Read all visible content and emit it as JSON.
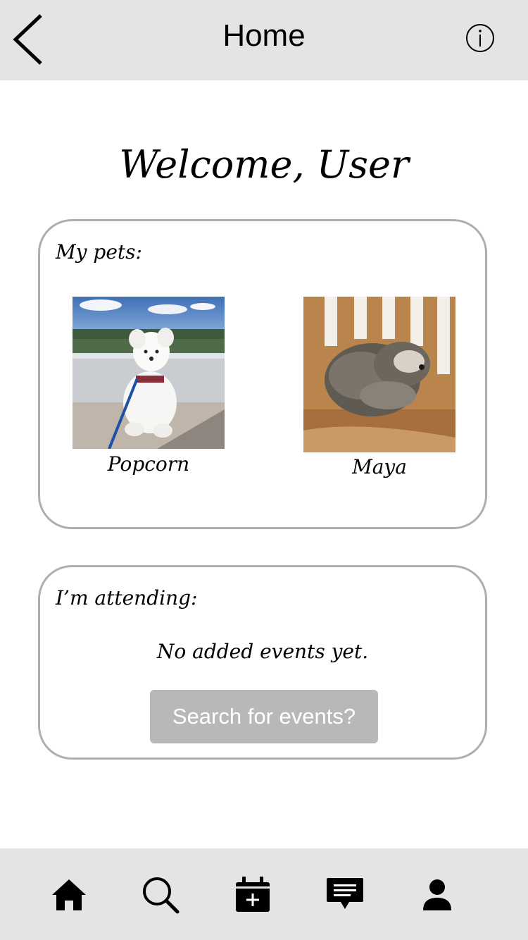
{
  "header": {
    "title": "Home",
    "back_icon": "chevron-left-icon",
    "info_icon": "info-circle-icon"
  },
  "welcome": {
    "text": "Welcome, User"
  },
  "pets_card": {
    "heading": "My pets:",
    "pets": [
      {
        "name": "Popcorn",
        "photo": "white dog sitting on sidewalk by water"
      },
      {
        "name": "Maya",
        "photo": "gray shaggy dog curled up on wooden chair"
      }
    ]
  },
  "events_card": {
    "heading": "I’m attending:",
    "empty_message": "No added events yet.",
    "button_label": "Search for events?"
  },
  "tabbar": {
    "tabs": [
      {
        "icon": "home-icon"
      },
      {
        "icon": "search-icon"
      },
      {
        "icon": "calendar-add-icon"
      },
      {
        "icon": "message-icon"
      },
      {
        "icon": "profile-icon"
      }
    ]
  },
  "colors": {
    "bar_background": "#e4e4e4",
    "card_border": "#aeaeae",
    "button_background": "#b8b8b8",
    "button_text": "#ffffff"
  }
}
